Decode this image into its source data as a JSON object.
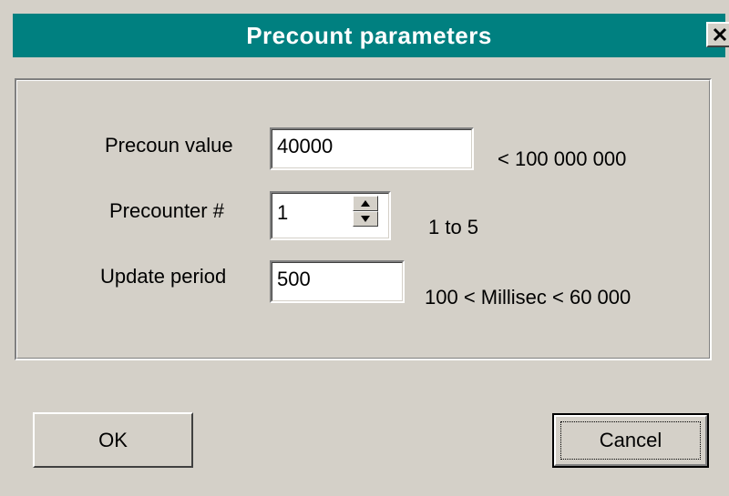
{
  "window": {
    "title": "Precount parameters",
    "close_label": "×"
  },
  "fields": {
    "precount_value": {
      "label": "Precoun value",
      "value": "40000",
      "hint": "< 100 000 000"
    },
    "precounter_number": {
      "label": "Precounter #",
      "value": "1",
      "hint": "1 to 5"
    },
    "update_period": {
      "label": "Update period",
      "value": "500",
      "hint": "100 < Millisec < 60 000"
    }
  },
  "buttons": {
    "ok_label": "OK",
    "cancel_label": "Cancel"
  },
  "colors": {
    "titlebar": "#008080",
    "dialog_face": "#d4d0c8"
  },
  "icons": {
    "close": "close-icon",
    "spin_up": "arrow-up-icon",
    "spin_down": "arrow-down-icon"
  }
}
